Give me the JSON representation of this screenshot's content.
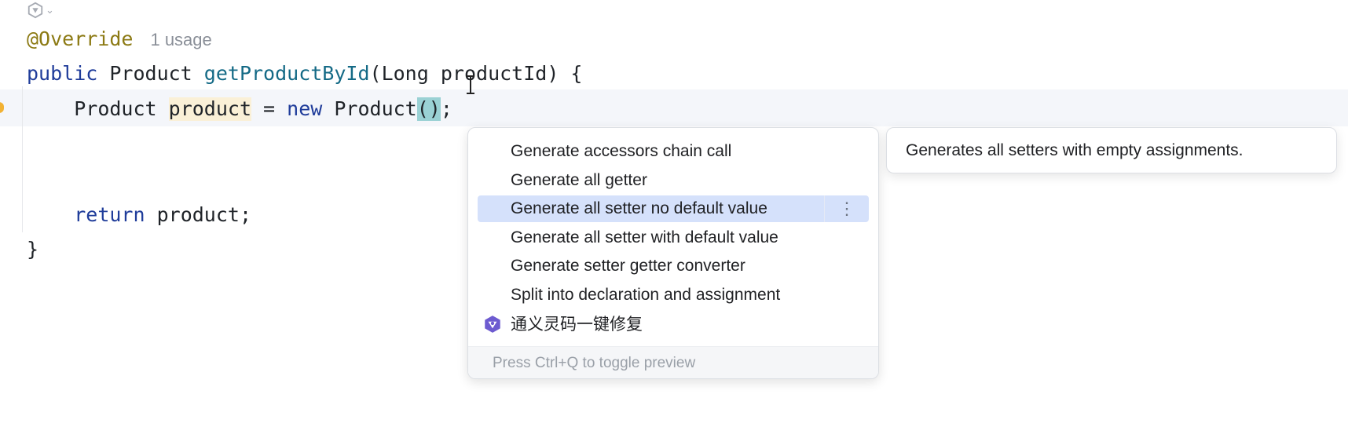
{
  "editor": {
    "ai_gutter_icon": "tongyi-icon",
    "lines": {
      "annotation": "@Override",
      "usage_hint": "1 usage",
      "sig_kw": "public",
      "sig_type": "Product",
      "sig_method": "getProductById",
      "sig_open": "(",
      "sig_param_type": "Long",
      "sig_param_name": "productId",
      "sig_close": ") {",
      "decl_type": "Product",
      "decl_var": "product",
      "decl_eq": " = ",
      "decl_new": "new",
      "decl_ctor": "Product",
      "decl_parens": "()",
      "decl_semi": ";",
      "return_kw": "return",
      "return_val": "product;",
      "close_brace": "}"
    }
  },
  "popup": {
    "items": [
      {
        "label": "Generate accessors chain call"
      },
      {
        "label": "Generate all getter"
      },
      {
        "label": "Generate all setter no default value",
        "selected": true
      },
      {
        "label": "Generate all setter with default value"
      },
      {
        "label": "Generate setter getter converter"
      },
      {
        "label": "Split into declaration and assignment"
      },
      {
        "label": "通义灵码一键修复",
        "icon": "tongyi-icon"
      }
    ],
    "more_icon": "⋮",
    "footer": "Press Ctrl+Q to toggle preview"
  },
  "preview": {
    "text": "Generates all setters with empty assignments."
  },
  "colors": {
    "selected_bg": "#d5e1fb",
    "keyword": "#1f3c9a",
    "annotation": "#8c7a14",
    "method": "#146a86",
    "paren_highlight": "#9ad1d4",
    "var_highlight": "#faf0d7"
  }
}
